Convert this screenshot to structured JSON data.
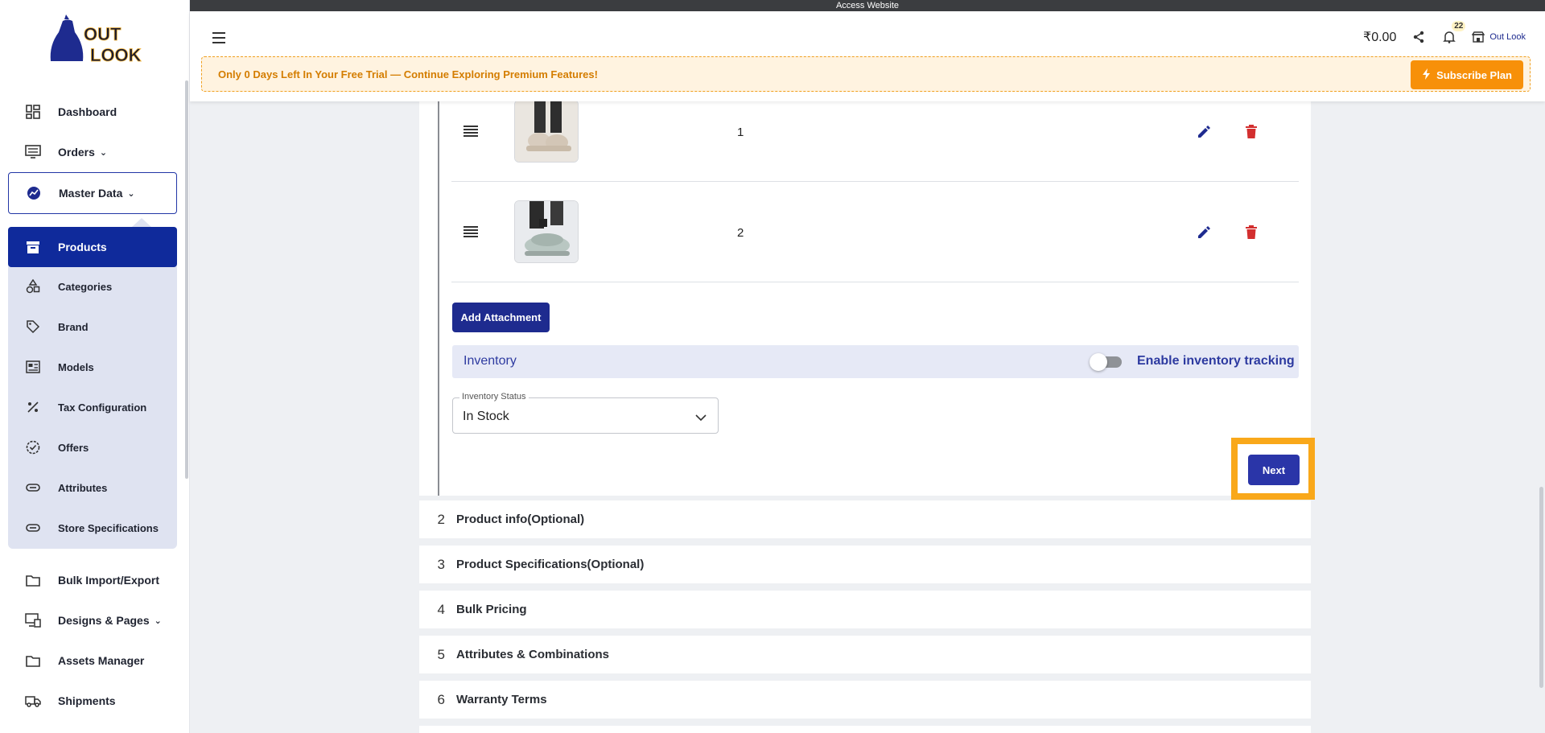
{
  "top_banner": {
    "text": "Access Website"
  },
  "header": {
    "wallet": "₹0.00",
    "notification_count": "22",
    "store_name": "Out Look",
    "trial_text": "Only 0 Days Left In Your Free Trial — Continue Exploring Premium Features!",
    "subscribe_label": "Subscribe Plan"
  },
  "sidebar": {
    "logo_text": "OUT LOOK",
    "items": [
      {
        "label": "Dashboard",
        "icon": "dashboard-icon"
      },
      {
        "label": "Orders",
        "icon": "orders-icon",
        "expandable": true
      },
      {
        "label": "Master Data",
        "icon": "master-data-icon",
        "expandable": true,
        "expanded": true
      },
      {
        "label": "Products",
        "icon": "products-icon",
        "active": true
      },
      {
        "label": "Categories",
        "icon": "categories-icon"
      },
      {
        "label": "Brand",
        "icon": "tag-icon"
      },
      {
        "label": "Models",
        "icon": "models-icon"
      },
      {
        "label": "Tax Configuration",
        "icon": "percent-icon"
      },
      {
        "label": "Offers",
        "icon": "offers-icon"
      },
      {
        "label": "Attributes",
        "icon": "attributes-icon"
      },
      {
        "label": "Store Specifications",
        "icon": "specifications-icon"
      },
      {
        "label": "Bulk Import/Export",
        "icon": "folder-icon"
      },
      {
        "label": "Designs & Pages",
        "icon": "designs-icon",
        "expandable": true
      },
      {
        "label": "Assets Manager",
        "icon": "folder-icon"
      },
      {
        "label": "Shipments",
        "icon": "truck-icon"
      }
    ]
  },
  "attachments": {
    "rows": [
      {
        "index": "1"
      },
      {
        "index": "2"
      }
    ],
    "add_label": "Add Attachment"
  },
  "inventory": {
    "title": "Inventory",
    "tracking_label": "Enable inventory tracking",
    "tracking_enabled": false,
    "status_label": "Inventory Status",
    "status_value": "In Stock"
  },
  "next_label": "Next",
  "steps": [
    {
      "num": "2",
      "title": "Product info(Optional)"
    },
    {
      "num": "3",
      "title": "Product Specifications(Optional)"
    },
    {
      "num": "4",
      "title": "Bulk Pricing"
    },
    {
      "num": "5",
      "title": "Attributes & Combinations"
    },
    {
      "num": "6",
      "title": "Warranty Terms"
    }
  ],
  "colors": {
    "primary": "#1e2b8f",
    "active_nav": "#0f2a9b",
    "delete": "#d32f2f",
    "subscribe": "#f79009",
    "highlight": "#f9a81a"
  }
}
